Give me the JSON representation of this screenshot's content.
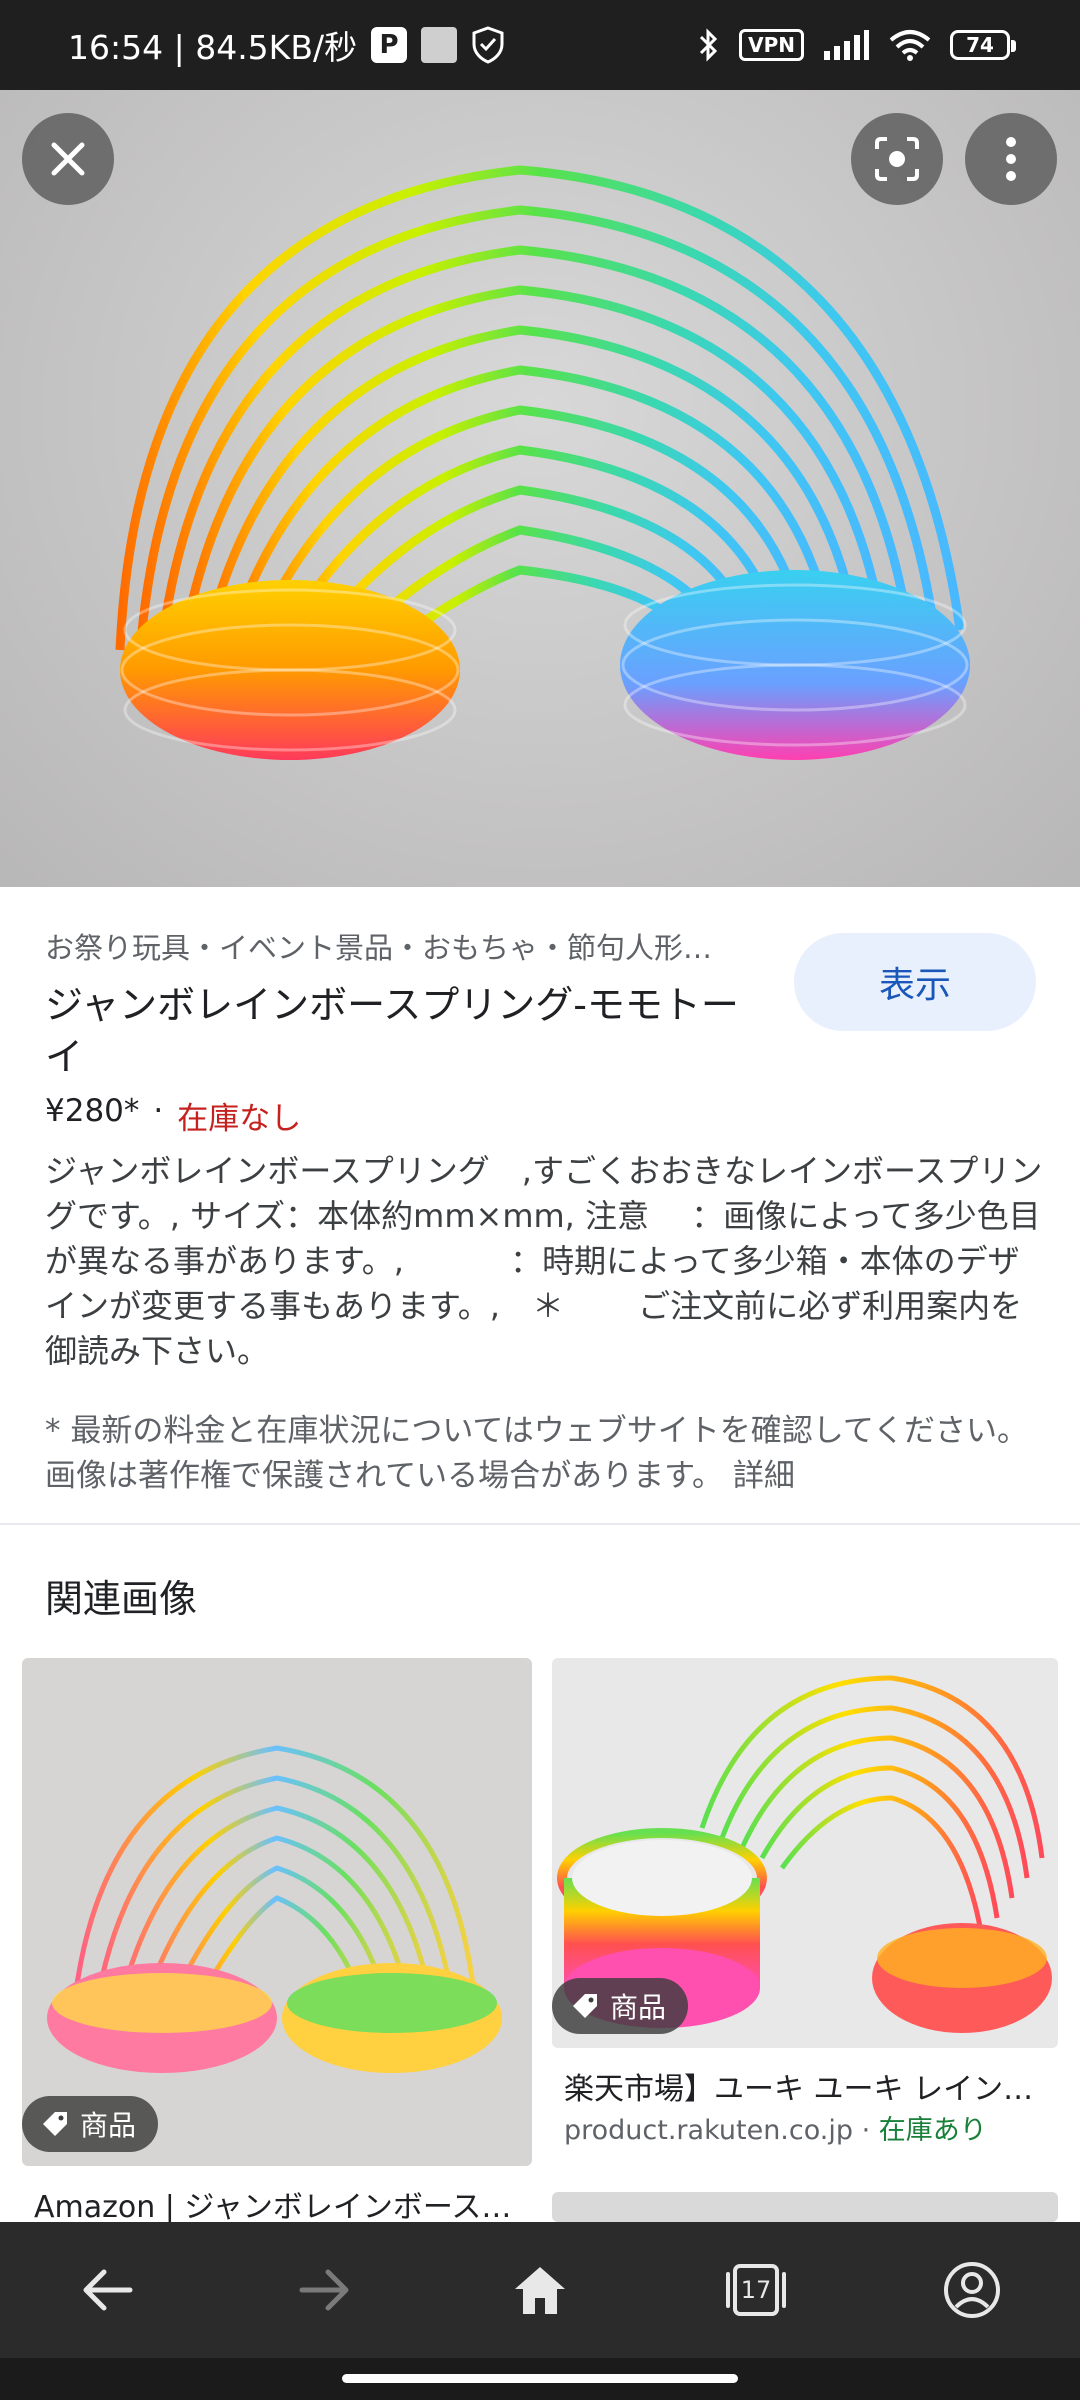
{
  "status_bar": {
    "time_speed": "16:54 | 84.5KB/秒",
    "vpn": "VPN",
    "battery": "74"
  },
  "hero": {
    "close_icon": "close-icon",
    "lens_icon": "google-lens-icon",
    "more_icon": "more-vert-icon"
  },
  "product": {
    "breadcrumb": "お祭り玩具・イベント景品・おもちゃ・節句人形…",
    "title": "ジャンボレインボースプリング-モモトーイ",
    "view_button": "表示",
    "price": "¥280*",
    "separator": "·",
    "stock": "在庫なし",
    "description": "ジャンボレインボースプリング　,すごくおおきなレインボースプリングです。, サイズ：本体約mm×mm, 注意　 ：画像によって多少色目が異なる事があります。,　　　 ：時期によって多少箱・本体のデザインが変更する事もあります。,　＊　　 ご注文前に必ず利用案内を御読み下さい。",
    "note": "* 最新の料金と在庫状況についてはウェブサイトを確認してください。 画像は著作権で保護されている場合があります。 詳細"
  },
  "related": {
    "heading": "関連画像",
    "cards": [
      {
        "tag": "商品",
        "title": "Amazon | ジャンボレインボース…"
      },
      {
        "tag": "商品",
        "title": "楽天市場】ユーキ ユーキ レイン…",
        "source": "product.rakuten.co.jp",
        "dot": " · ",
        "stock": "在庫あり"
      }
    ]
  },
  "bottom_nav": {
    "tab_count": "17",
    "items": [
      "back-icon",
      "forward-icon",
      "home-icon",
      "tabs-icon",
      "account-icon"
    ]
  },
  "colors": {
    "accent_button_bg": "#e8f0fe",
    "accent_button_text": "#1a57b8",
    "out_of_stock": "#c5221f",
    "in_stock": "#188038"
  }
}
